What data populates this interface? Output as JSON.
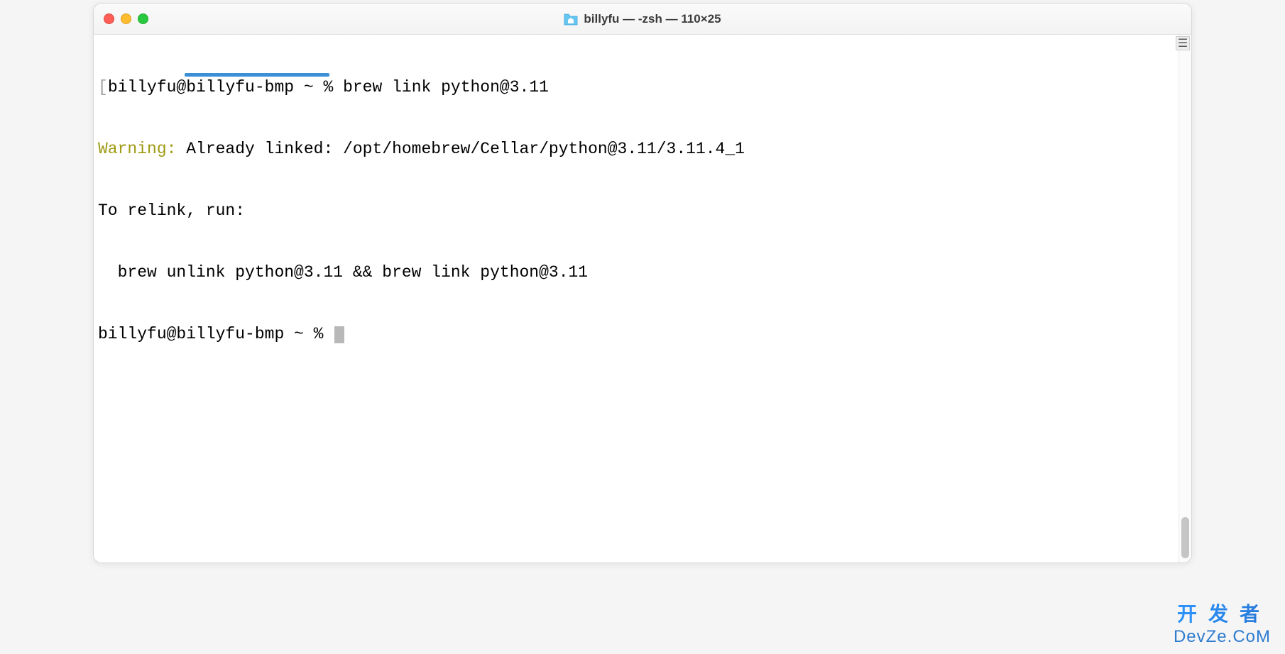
{
  "window": {
    "title": "billyfu — -zsh — 110×25"
  },
  "terminal": {
    "line1_bracket": "[",
    "line1_prompt": "billyfu@billyfu-bmp ~ % ",
    "line1_cmd": "brew link python@3.11",
    "line2_warning": "Warning:",
    "line2_rest": " Already linked: /opt/homebrew/Cellar/python@3.11/3.11.4_1",
    "line3": "To relink, run:",
    "line4": "  brew unlink python@3.11 && brew link python@3.11",
    "line5_prompt": "billyfu@billyfu-bmp ~ % "
  },
  "watermark": {
    "line1": "开发者",
    "line2": "DevZe.CoM"
  }
}
